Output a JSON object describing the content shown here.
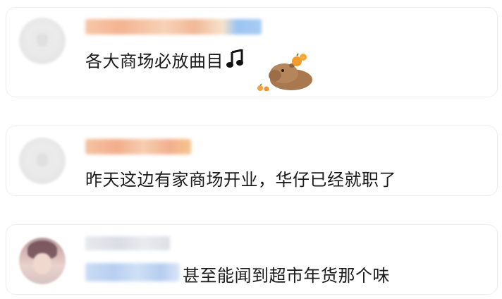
{
  "comments": [
    {
      "text": "各大商场必放曲目",
      "icons": [
        "music-note-icon",
        "capybara-sticker-icon"
      ]
    },
    {
      "text": "昨天这边有家商场开业，华仔已经就职了"
    },
    {
      "text": "甚至能闻到超市年货那个味"
    }
  ],
  "colors": {
    "text": "#1a1a1a",
    "card_border": "#ededed",
    "background": "#ffffff"
  }
}
